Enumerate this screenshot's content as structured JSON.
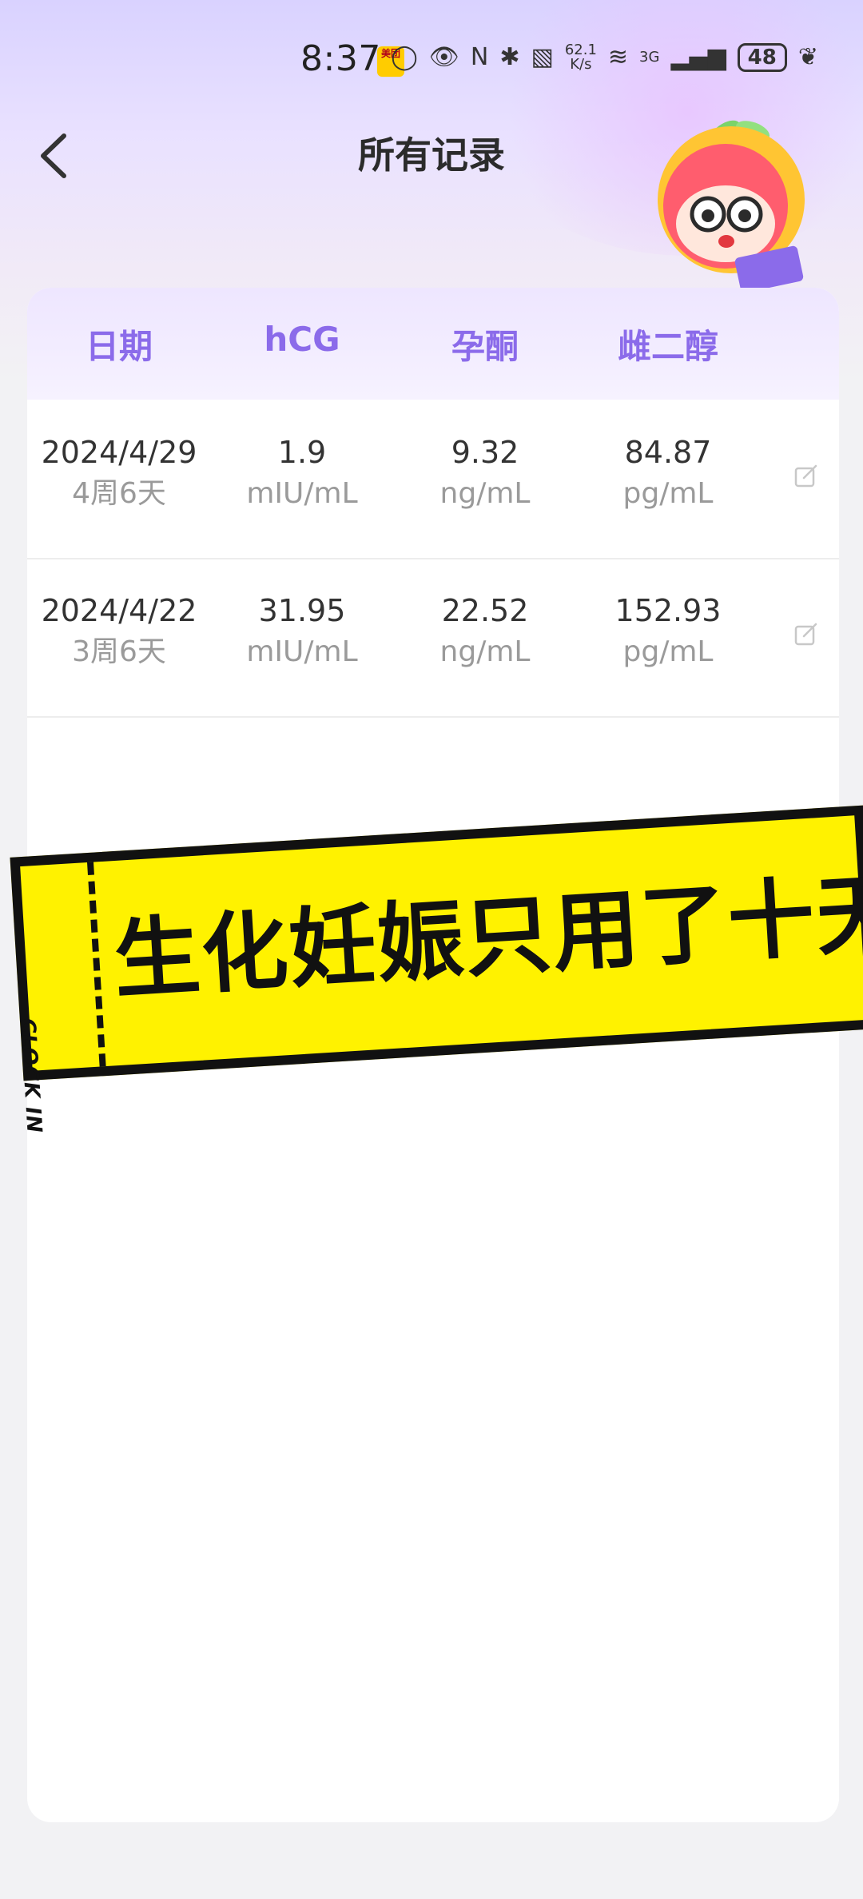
{
  "status_bar": {
    "time": "8:37",
    "app_badge": "美团",
    "network_speed_value": "62.1",
    "network_speed_unit": "K/s",
    "network_type": "3G",
    "battery": "48"
  },
  "header": {
    "title": "所有记录"
  },
  "table": {
    "columns": [
      "日期",
      "hCG",
      "孕酮",
      "雌二醇"
    ],
    "rows": [
      {
        "date": "2024/4/29",
        "week": "4周6天",
        "hcg": "1.9",
        "hcg_unit": "mIU/mL",
        "progesterone": "9.32",
        "progesterone_unit": "ng/mL",
        "estradiol": "84.87",
        "estradiol_unit": "pg/mL"
      },
      {
        "date": "2024/4/22",
        "week": "3周6天",
        "hcg": "31.95",
        "hcg_unit": "mIU/mL",
        "progesterone": "22.52",
        "progesterone_unit": "ng/mL",
        "estradiol": "152.93",
        "estradiol_unit": "pg/mL"
      }
    ]
  },
  "banner": {
    "stub_text": "CLOCK IN",
    "main_text": "生化妊娠只用了十天"
  },
  "icons": {
    "back": "chevron-left-icon",
    "edit": "edit-icon",
    "mascot": "mascot-illustration"
  },
  "colors": {
    "accent": "#8b6bea",
    "banner": "#fff200"
  }
}
